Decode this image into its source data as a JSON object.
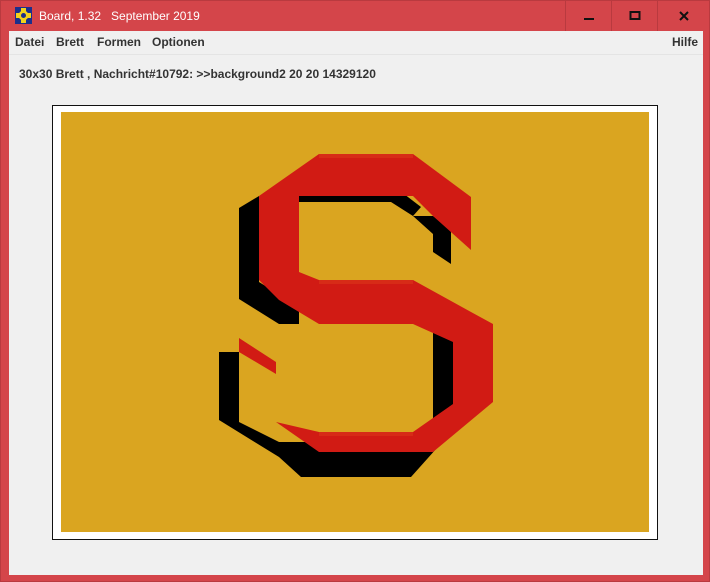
{
  "window": {
    "title": "Board, 1.32   September 2019",
    "minimize_icon": "minimize-icon",
    "maximize_icon": "maximize-icon",
    "close_icon": "close-icon"
  },
  "menu": {
    "datei": "Datei",
    "brett": "Brett",
    "formen": "Formen",
    "optionen": "Optionen",
    "hilfe": "Hilfe"
  },
  "status": {
    "text": "30x30 Brett , Nachricht#10792: >>background2 20 20 14329120"
  },
  "colors": {
    "title_bar": "#d4454a",
    "board_background": "#daa520",
    "letter_red": "#d11b14",
    "letter_shadow": "#000000"
  },
  "board": {
    "letter": "S"
  }
}
